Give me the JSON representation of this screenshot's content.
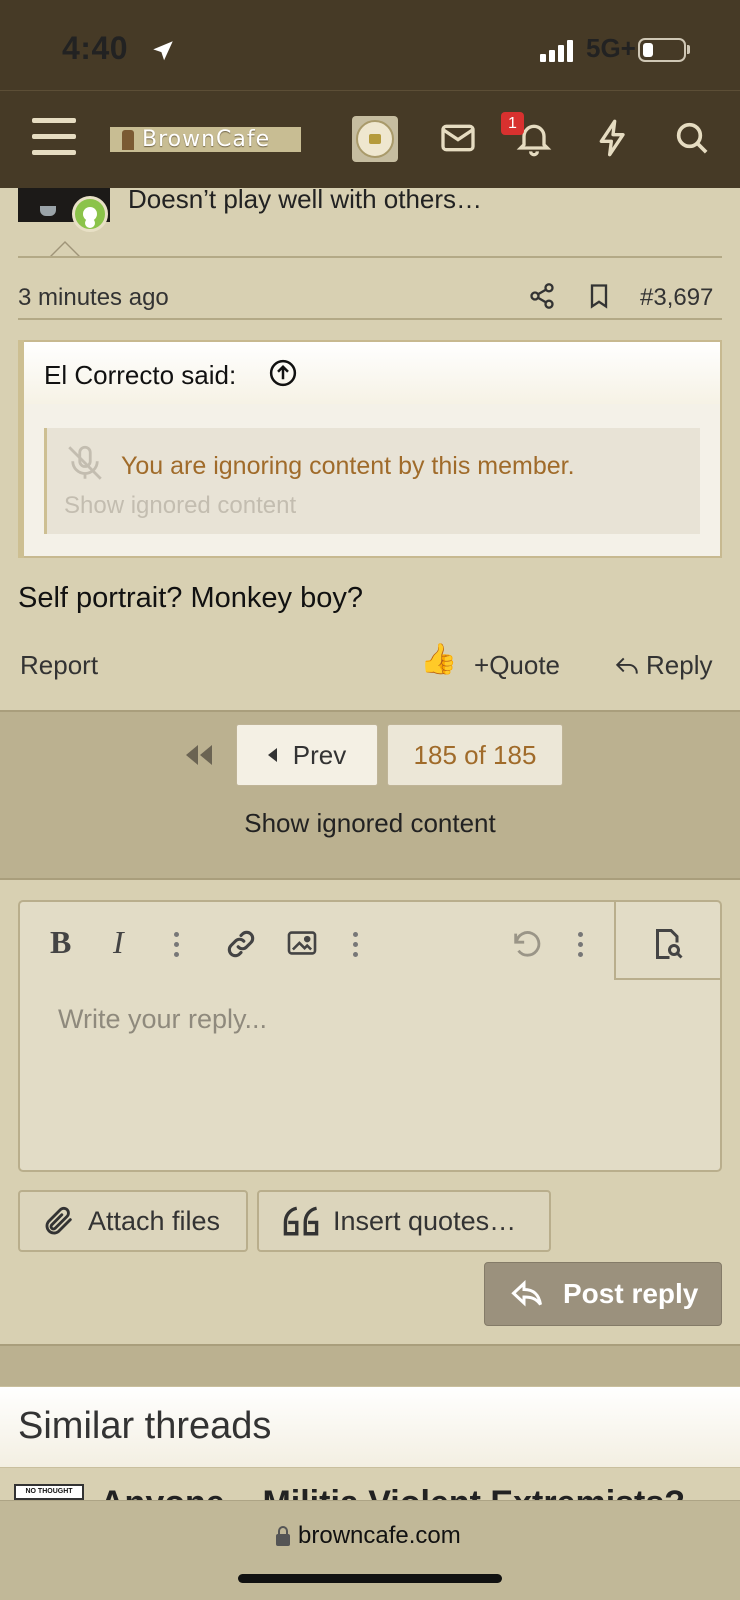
{
  "status_bar": {
    "time": "4:40",
    "network": "5G+"
  },
  "nav": {
    "logo_text": "BrownCafe",
    "notification_count": "1"
  },
  "post": {
    "user_title": "Doesn’t play well with others…",
    "time": "3 minutes ago",
    "number": "#3,697",
    "quote": {
      "author_line": "El Correcto said:",
      "ignored_message": "You are ignoring content by this member.",
      "show_ignored": "Show ignored content"
    },
    "body": "Self portrait? Monkey boy?",
    "actions": {
      "report": "Report",
      "quote": "Quote",
      "reply": "Reply"
    }
  },
  "pagination": {
    "prev": "Prev",
    "current": "185 of 185",
    "show_ignored": "Show ignored content"
  },
  "editor": {
    "bold": "B",
    "italic": "I",
    "placeholder": "Write your reply...",
    "attach": "Attach files",
    "insert_quotes": "Insert quotes…",
    "post_reply": "Post reply"
  },
  "similar": {
    "title": "Similar threads",
    "thumb_text": "NO THOUGHT",
    "first_thread_partial": "Anyone... Militia Violent Extremists?"
  },
  "browser": {
    "url": "browncafe.com"
  },
  "colors": {
    "header_bg": "#463a26",
    "page_bg": "#d8d0b2",
    "accent": "#a06b2a",
    "online": "#8bc34a",
    "badge": "#d8312f"
  }
}
